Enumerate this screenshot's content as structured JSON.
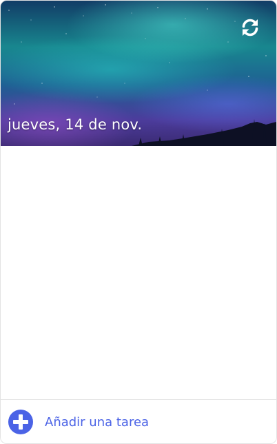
{
  "header": {
    "date": "jueves, 14 de nov.",
    "refresh_icon": "refresh-icon"
  },
  "footer": {
    "add_task_label": "Añadir una tarea",
    "add_icon": "plus-circle-icon"
  },
  "colors": {
    "accent": "#4b63e6",
    "border": "#e3e3e3"
  }
}
